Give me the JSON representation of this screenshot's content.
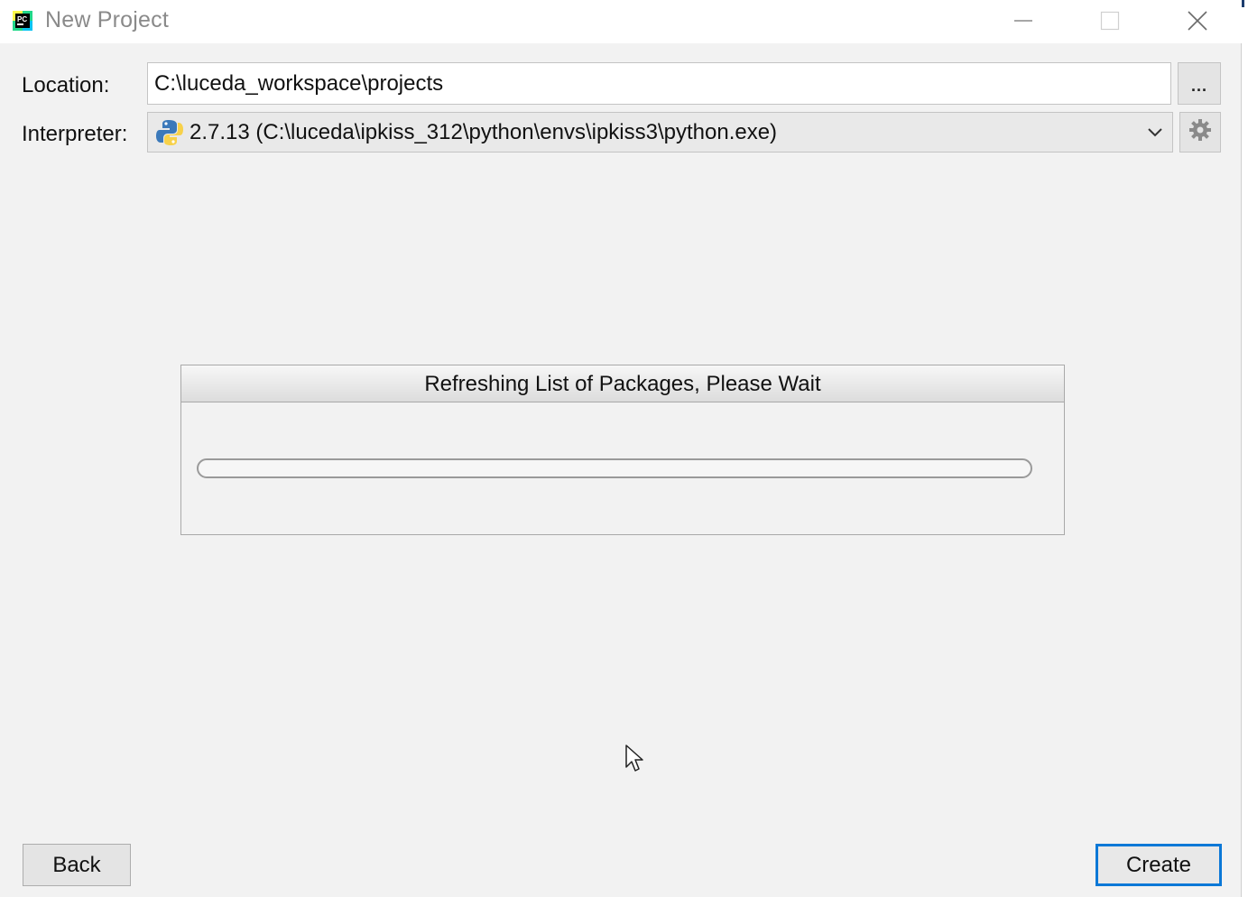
{
  "window": {
    "title": "New Project",
    "controls": {
      "minimize": "minimize-icon",
      "maximize": "maximize-icon",
      "close": "close-icon"
    }
  },
  "form": {
    "location": {
      "label": "Location:",
      "value": "C:\\luceda_workspace\\projects",
      "browse_label": "..."
    },
    "interpreter": {
      "label": "Interpreter:",
      "selected": "2.7.13 (C:\\luceda\\ipkiss_312\\python\\envs\\ipkiss3\\python.exe)",
      "icon": "python-icon",
      "settings_icon": "gear-icon"
    }
  },
  "progress": {
    "title": "Refreshing List of Packages, Please Wait",
    "fraction": 0
  },
  "buttons": {
    "back": "Back",
    "create": "Create"
  },
  "colors": {
    "accent": "#0b78d7",
    "background": "#f2f2f2"
  }
}
